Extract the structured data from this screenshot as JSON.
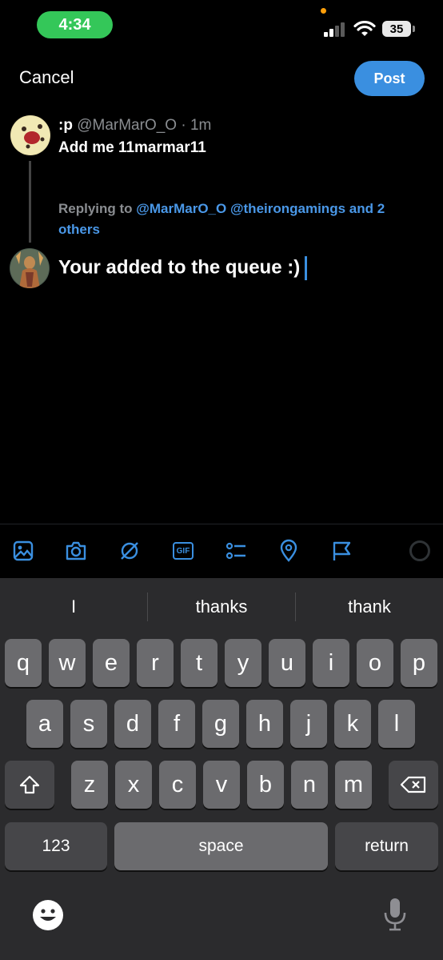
{
  "status_bar": {
    "time": "4:34",
    "battery": "35"
  },
  "header": {
    "cancel_label": "Cancel",
    "post_label": "Post"
  },
  "original_post": {
    "display_name": ":p",
    "handle_time": "@MarMarO_O · 1m",
    "text": "Add me 11marmar11"
  },
  "reply": {
    "prefix": "Replying to ",
    "mentions": "@MarMarO_O @theirongamings and 2 others",
    "draft_text": "Your added to the queue :)"
  },
  "toolbar": {
    "icons": [
      "image-icon",
      "camera-icon",
      "grok-icon",
      "gif-icon",
      "poll-icon",
      "location-icon",
      "flag-icon"
    ],
    "gif_label": "GIF",
    "accent_color": "#3a8fe0"
  },
  "keyboard": {
    "suggestions": [
      "I",
      "thanks",
      "thank"
    ],
    "row1": [
      "q",
      "w",
      "e",
      "r",
      "t",
      "y",
      "u",
      "i",
      "o",
      "p"
    ],
    "row2": [
      "a",
      "s",
      "d",
      "f",
      "g",
      "h",
      "j",
      "k",
      "l"
    ],
    "row3": [
      "z",
      "x",
      "c",
      "v",
      "b",
      "n",
      "m"
    ],
    "numbers_label": "123",
    "space_label": "space",
    "return_label": "return"
  }
}
